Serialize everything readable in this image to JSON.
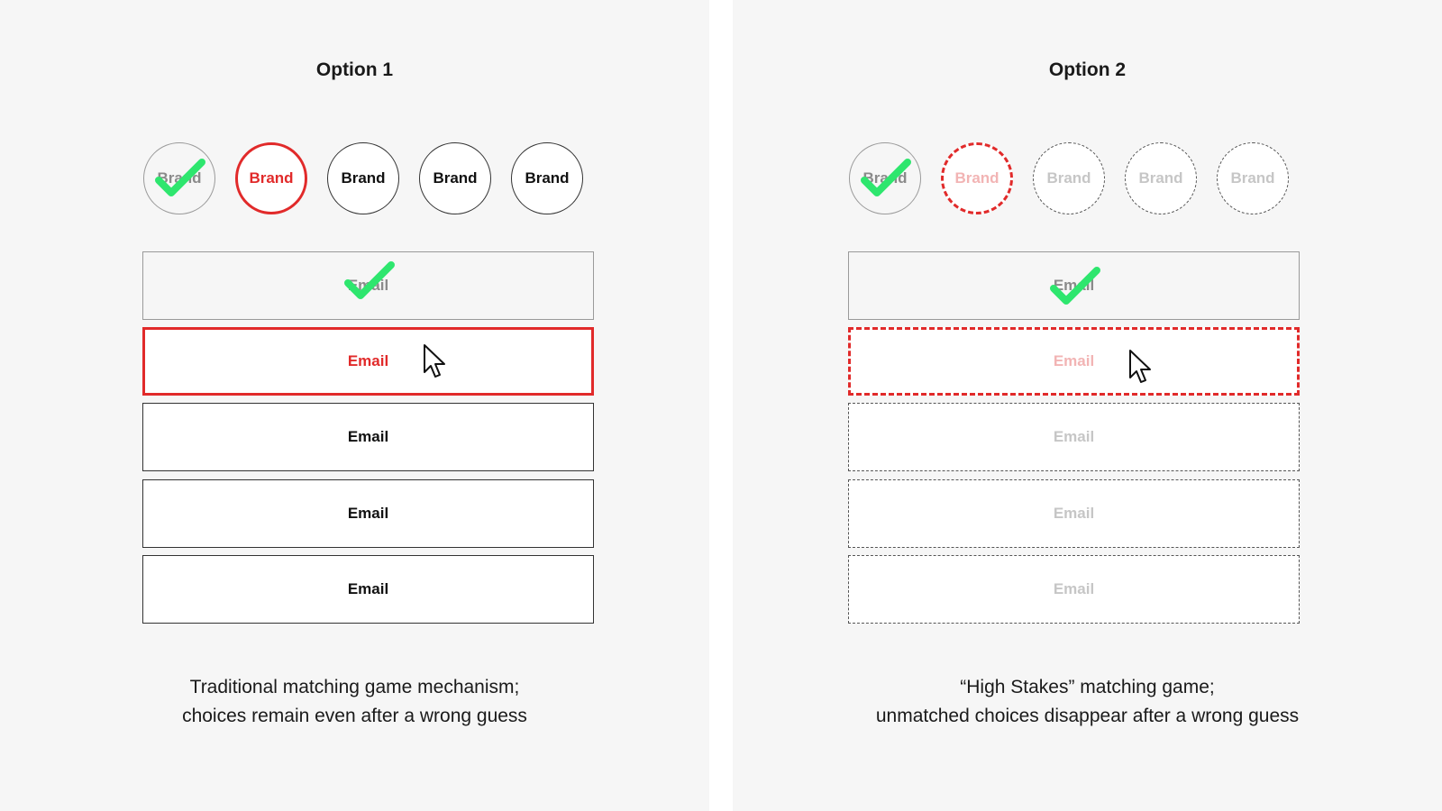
{
  "colors": {
    "panel_bg": "#f6f6f6",
    "error_red": "#e12a2a",
    "check_green": "#2ee66e",
    "faded_text": "#c6c6c6"
  },
  "icons": [
    "check-icon",
    "mouse-pointer-icon"
  ],
  "option1": {
    "title": "Option 1",
    "brands": [
      "Brand",
      "Brand",
      "Brand",
      "Brand",
      "Brand"
    ],
    "brand_states": [
      "matched",
      "wrong",
      "normal",
      "normal",
      "normal"
    ],
    "emails": [
      "Email",
      "Email",
      "Email",
      "Email",
      "Email"
    ],
    "email_states": [
      "matched",
      "wrong",
      "normal",
      "normal",
      "normal"
    ],
    "caption_line1": "Traditional matching game mechanism;",
    "caption_line2": "choices remain even after a wrong guess"
  },
  "option2": {
    "title": "Option 2",
    "brands": [
      "Brand",
      "Brand",
      "Brand",
      "Brand",
      "Brand"
    ],
    "brand_states": [
      "matched",
      "wrong-dashed",
      "faded",
      "faded",
      "faded"
    ],
    "emails": [
      "Email",
      "Email",
      "Email",
      "Email",
      "Email"
    ],
    "email_states": [
      "matched",
      "wrong-dashed",
      "faded",
      "faded",
      "faded"
    ],
    "caption_line1": "“High Stakes” matching game;",
    "caption_line2": "unmatched choices disappear after a wrong guess"
  }
}
